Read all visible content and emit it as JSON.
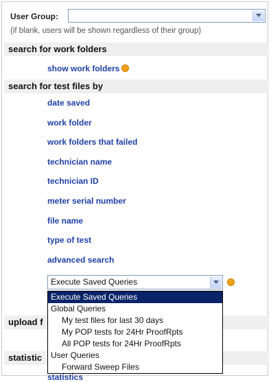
{
  "user_group": {
    "label": "User Group:",
    "value": "",
    "hint": "(if blank, users will be shown regardless of their group)"
  },
  "sections": {
    "work_folders": {
      "header": "search for work folders",
      "link": "show work folders"
    },
    "test_files": {
      "header": "search for test files by",
      "links": [
        "date saved",
        "work folder",
        "work folders that failed",
        "technician name",
        "technician ID",
        "meter serial number",
        "file name",
        "type of test",
        "advanced search"
      ]
    },
    "upload": {
      "header_visible": "upload f"
    },
    "statistics": {
      "header_visible": "statistic",
      "link": "statistics"
    }
  },
  "saved_queries": {
    "selected": "Execute Saved Queries",
    "options": [
      {
        "label": "Execute Saved Queries",
        "kind": "selected"
      },
      {
        "label": "Global Queries",
        "kind": "group"
      },
      {
        "label": "My test files for last 30 days",
        "kind": "item"
      },
      {
        "label": "My POP tests for 24Hr ProofRpts",
        "kind": "item"
      },
      {
        "label": "All POP tests for 24Hr ProofRpts",
        "kind": "item"
      },
      {
        "label": "User Queries",
        "kind": "group"
      },
      {
        "label": "Forward Sweep Files",
        "kind": "item"
      }
    ]
  },
  "colors": {
    "link": "#1f3fa6",
    "section_bg": "#efefef",
    "dropdown_selected_bg": "#0a246a",
    "info_icon": "#f0a21a"
  },
  "icons": [
    "chevron-down-icon",
    "info-icon"
  ]
}
